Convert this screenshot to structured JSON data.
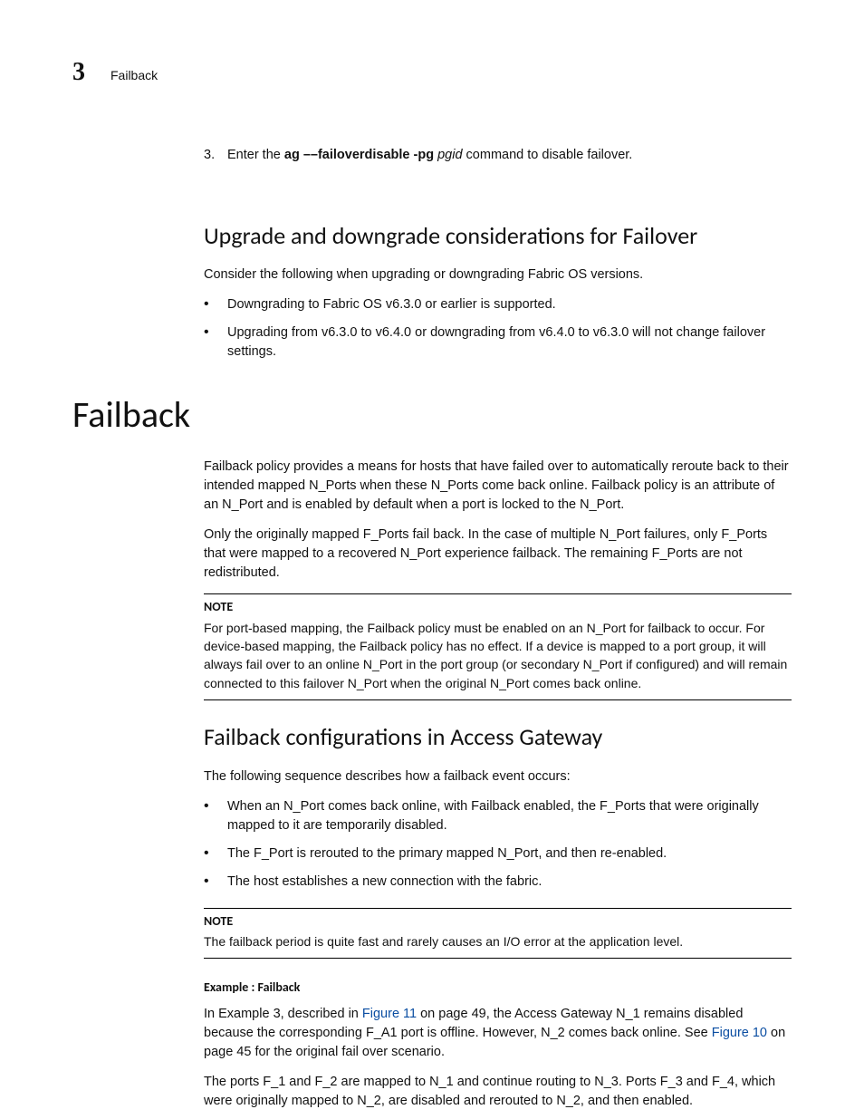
{
  "header": {
    "chapter": "3",
    "crumb": "Failback"
  },
  "step": {
    "num": "3.",
    "before": "Enter the ",
    "cmd": "ag ––failoverdisable -pg",
    "arg": "pgid",
    "after": " command to disable failover."
  },
  "sec1": {
    "h": "Upgrade and downgrade considerations for Failover",
    "p": "Consider the following when upgrading or downgrading Fabric OS versions.",
    "b1": "Downgrading to Fabric OS v6.3.0 or earlier is supported.",
    "b2": "Upgrading from v6.3.0 to v6.4.0 or downgrading from v6.4.0 to v6.3.0 will not change failover settings."
  },
  "sec2": {
    "h": "Failback",
    "p1": "Failback policy provides a means for hosts that have failed over to automatically reroute back to their intended mapped N_Ports when these N_Ports come back online. Failback policy is an attribute of an N_Port and is enabled by default when a port is locked to the N_Port.",
    "p2": "Only the originally mapped F_Ports fail back. In the case of multiple N_Port failures, only F_Ports that were mapped to a recovered N_Port experience failback. The remaining F_Ports are not redistributed.",
    "note": {
      "label": "NOTE",
      "body": "For port-based mapping, the Failback policy must be enabled on an N_Port for failback to occur. For device-based mapping, the Failback policy has no effect. If a device is mapped to a port group, it will always fail over to an online N_Port in the port group (or secondary N_Port if configured) and will remain connected to this failover N_Port when the original N_Port comes back online."
    }
  },
  "sec3": {
    "h": "Failback configurations in Access Gateway",
    "p": "The following sequence describes how a failback event occurs:",
    "b1": "When an N_Port comes back online, with Failback enabled, the F_Ports that were originally mapped to it are temporarily disabled.",
    "b2": "The F_Port is rerouted to the primary mapped N_Port, and then re-enabled.",
    "b3": "The host establishes a new connection with the fabric.",
    "note": {
      "label": "NOTE",
      "body": "The failback period is quite fast and rarely causes an I/O error at the application level."
    },
    "ex": {
      "head": "Example : Failback",
      "p1a": "In Example 3, described in ",
      "link1": "Figure 11",
      "p1b": " on page 49, the Access Gateway N_1 remains disabled because the corresponding F_A1 port is offline. However, N_2 comes back online. See ",
      "link2": "Figure 10",
      "p1c": " on page 45 for the original fail over scenario.",
      "p2": "The ports F_1 and F_2 are mapped to N_1 and continue routing to N_3. Ports F_3 and F_4, which were originally mapped to N_2, are disabled and rerouted to N_2, and then enabled."
    }
  }
}
